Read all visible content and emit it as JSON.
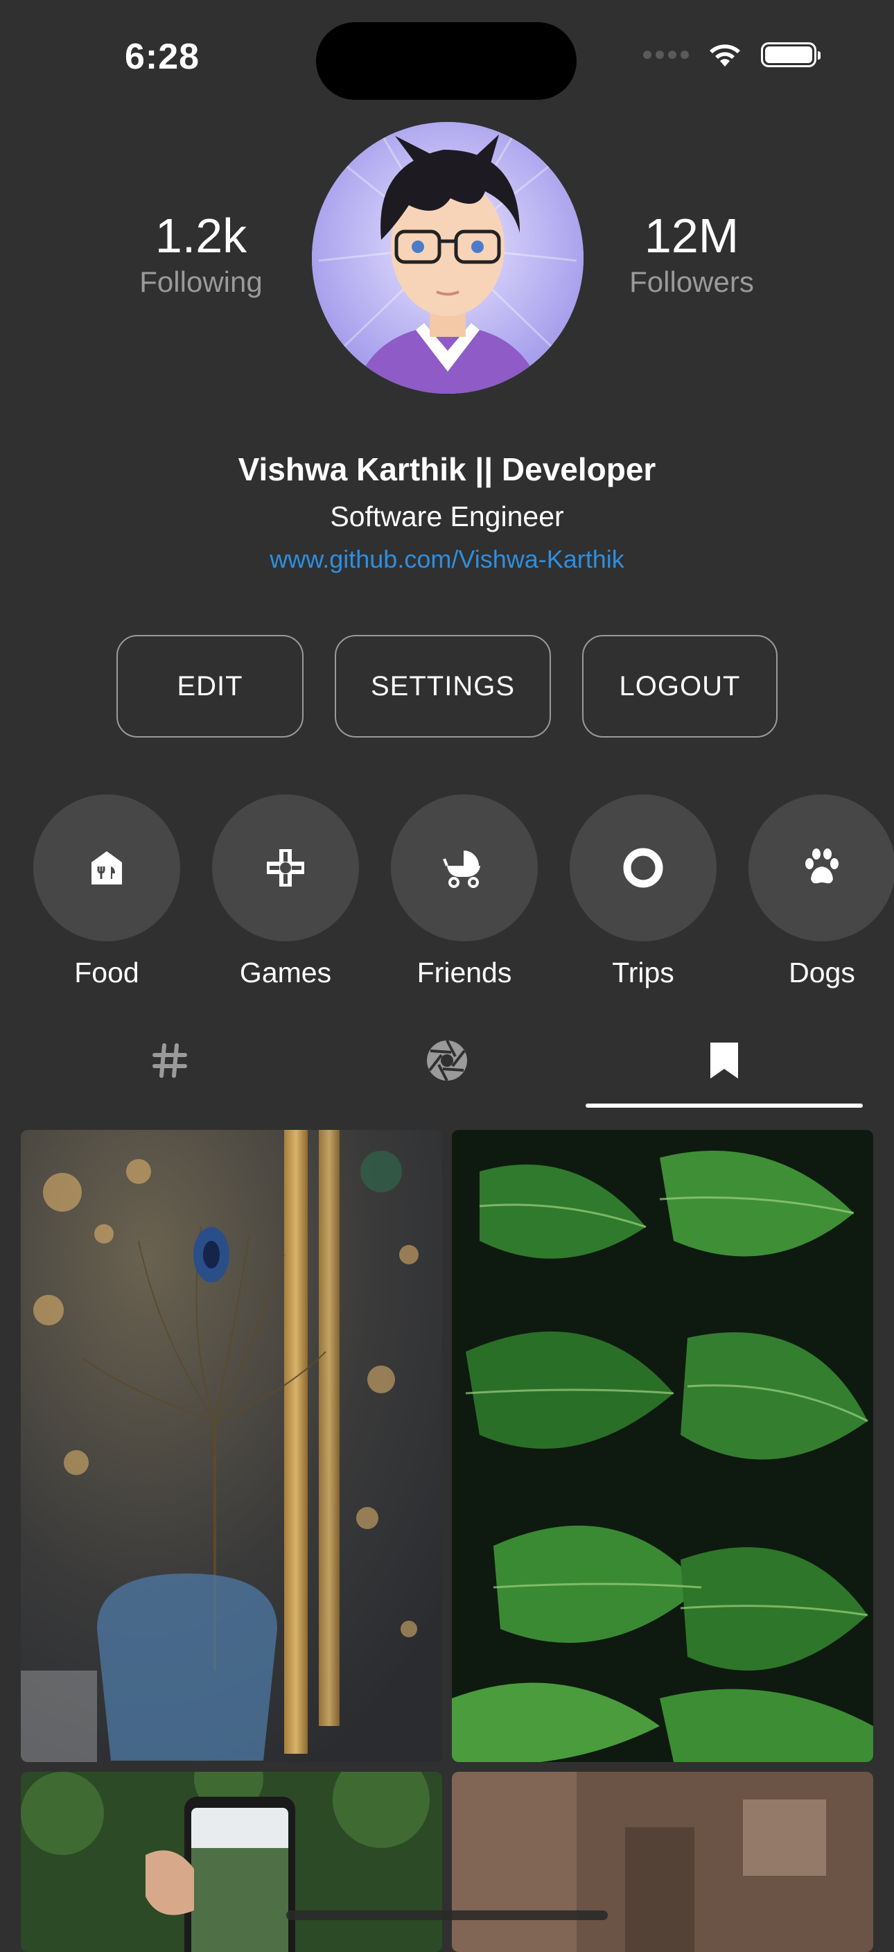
{
  "status": {
    "time": "6:28"
  },
  "profile": {
    "following": {
      "count": "1.2k",
      "label": "Following"
    },
    "followers": {
      "count": "12M",
      "label": "Followers"
    },
    "name": "Vishwa Karthik || Developer",
    "role": "Software Engineer",
    "link": "www.github.com/Vishwa-Karthik"
  },
  "actions": {
    "edit": "EDIT",
    "settings": "SETTINGS",
    "logout": "LOGOUT"
  },
  "highlights": [
    {
      "label": "Food",
      "icon": "food-bag-icon"
    },
    {
      "label": "Games",
      "icon": "gamepad-icon"
    },
    {
      "label": "Friends",
      "icon": "stroller-icon"
    },
    {
      "label": "Trips",
      "icon": "ring-icon"
    },
    {
      "label": "Dogs",
      "icon": "paw-icon"
    }
  ],
  "tabs": [
    {
      "icon": "hashtag-icon",
      "active": false
    },
    {
      "icon": "aperture-icon",
      "active": false
    },
    {
      "icon": "bookmark-icon",
      "active": true
    }
  ],
  "colors": {
    "background": "#303030",
    "link": "#2d8fe0",
    "circle": "#474747"
  }
}
